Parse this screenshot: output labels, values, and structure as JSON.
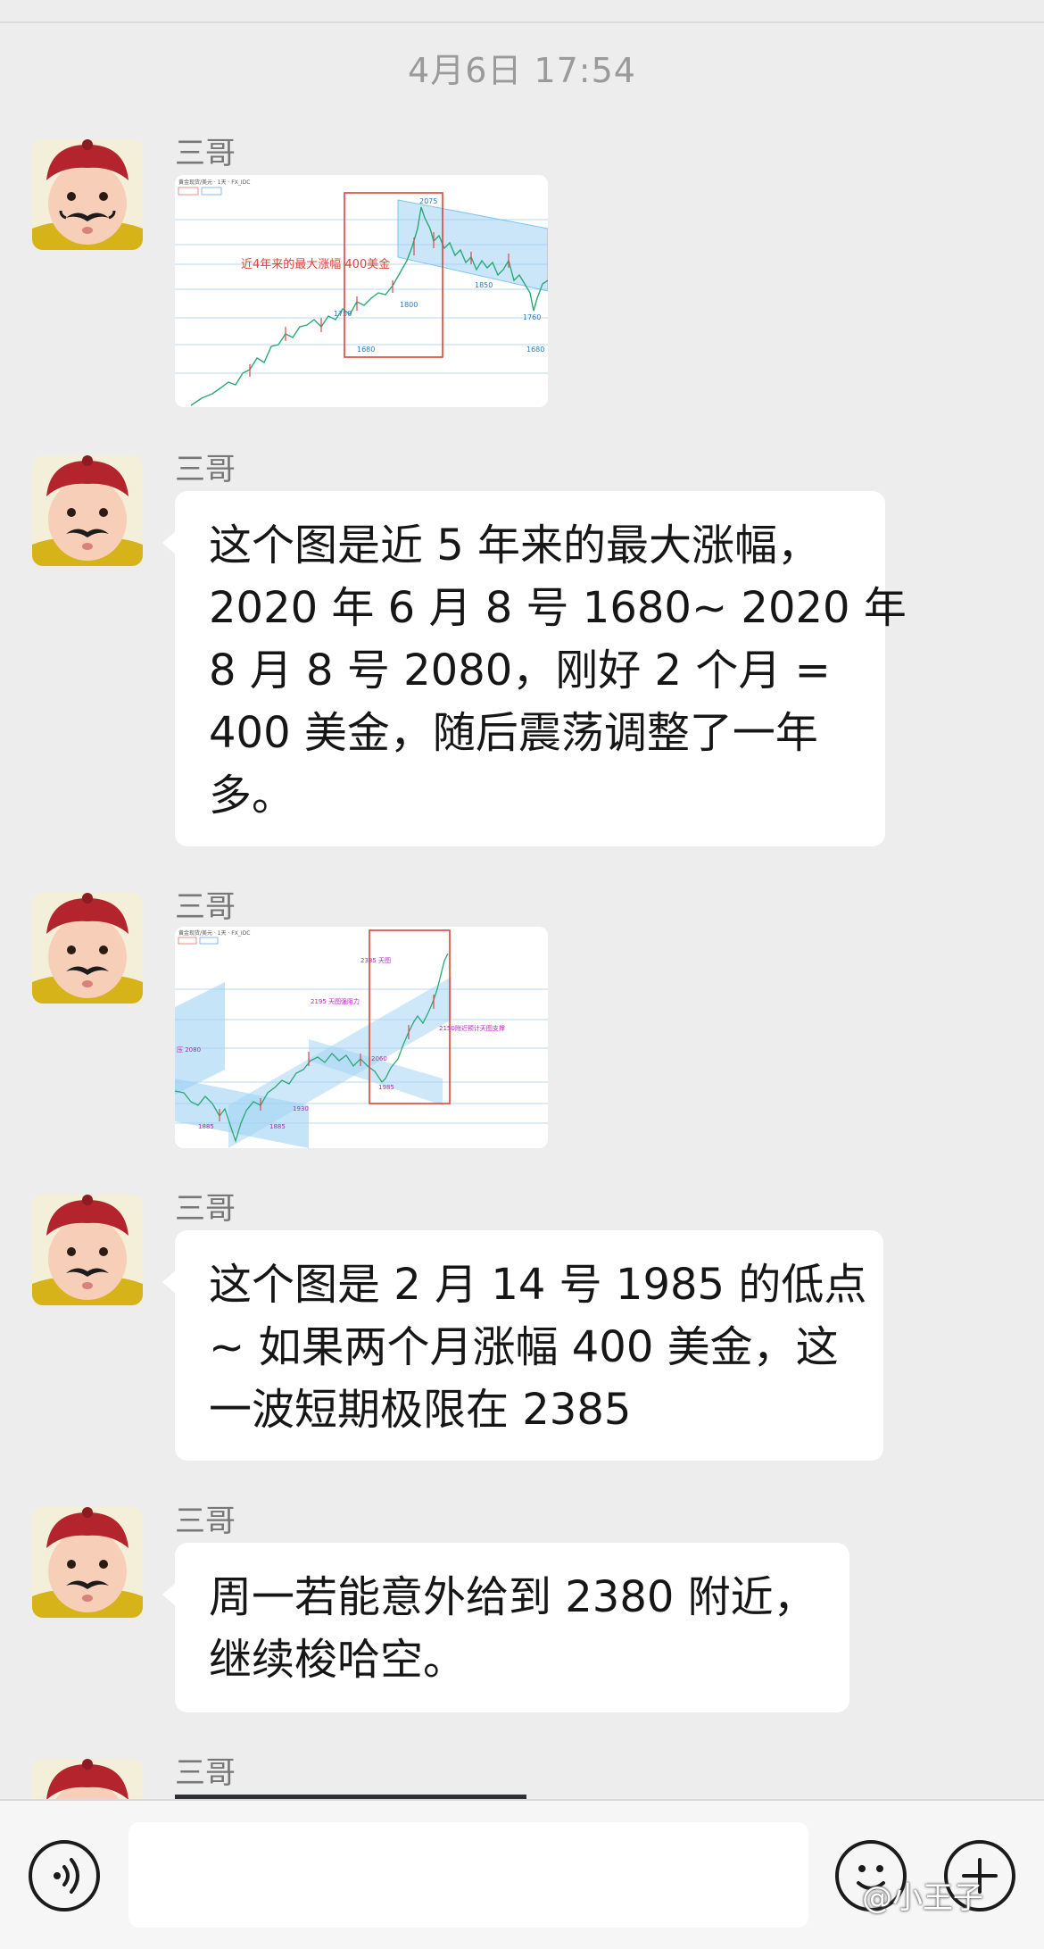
{
  "timestamp": "4月6日 17:54",
  "sender_name": "三哥",
  "chart1": {
    "legend_title": "黄金现货/美元 · 1天 · FX_IDC",
    "annotation": "近4年来的最大涨幅 400美金",
    "levels": [
      "2075",
      "1750",
      "1800",
      "1680",
      "1850",
      "1760",
      "1680"
    ]
  },
  "message1": {
    "lines": [
      "这个图是近 5 年来的最大涨幅，",
      "2020 年 6 月 8 号 1680~ 2020 年",
      "8 月 8 号 2080，刚好 2 个月 =",
      "400 美金，随后震荡调整了一年",
      "多。"
    ]
  },
  "chart2": {
    "legend_title": "黄金现货/美元 · 1天 · FX_IDC",
    "annotations": {
      "top": "2385 天图",
      "resist": "2195 天图强阻力",
      "support": "2150附近预计天图支撑",
      "left": "压 2080"
    },
    "levels": [
      "2060",
      "1985",
      "1930",
      "1885",
      "1885"
    ]
  },
  "message2": {
    "lines": [
      "这个图是 2 月 14 号 1985 的低点",
      "~ 如果两个月涨幅 400 美金，这",
      "一波短期极限在 2385"
    ]
  },
  "message3": {
    "lines": [
      "周一若能意外给到 2380 附近，",
      "继续梭哈空。"
    ]
  },
  "watermark": "@小王子",
  "colors": {
    "background": "#ededed",
    "bubble": "#ffffff",
    "frame_red": "#d9463a",
    "channel_blue": "#7fc4ef"
  }
}
